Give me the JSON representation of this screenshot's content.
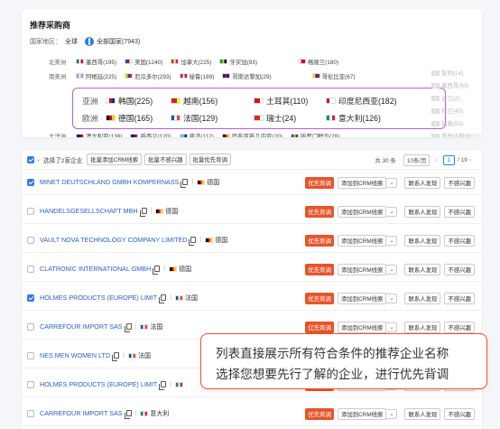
{
  "top_panel": {
    "title": "推荐采购商",
    "country_label": "国家地区：",
    "all_label": "全球",
    "all_countries": "全部国家(7943)",
    "regions": [
      {
        "name": "北美洲",
        "items": [
          {
            "label": "墨西哥(195)",
            "flag": [
              "#0a7a3a",
              "#fff",
              "#c8102e"
            ]
          },
          {
            "label": "美国(1240)",
            "flag": [
              "#2b4f9e",
              "#c8102e",
              "#fff"
            ]
          },
          {
            "label": "加拿大(225)",
            "flag": [
              "#d52b1e",
              "#fff",
              "#d52b1e"
            ]
          },
          {
            "label": "牙买加(93)",
            "flag": [
              "#009b3a",
              "#fed100",
              "#000"
            ]
          },
          {
            "label": "格陵兰(180)",
            "flag": [
              "#fff",
              "#c8102e",
              "#c8102e"
            ]
          }
        ]
      },
      {
        "name": "南美洲",
        "items": [
          {
            "label": "阿根廷(225)",
            "flag": [
              "#74acdf",
              "#fff",
              "#74acdf"
            ]
          },
          {
            "label": "厄瓜多尔(293)",
            "flag": [
              "#ffd100",
              "#034ea2",
              "#ed1c24"
            ]
          },
          {
            "label": "秘鲁(189)",
            "flag": [
              "#d91023",
              "#fff",
              "#d91023"
            ]
          },
          {
            "label": "哥斯达黎加(29)",
            "flag": [
              "#002b7f",
              "#ce1126",
              "#002b7f"
            ]
          },
          {
            "label": "哥伦比亚(67)",
            "flag": [
              "#fcd116",
              "#003893",
              "#ce1126"
            ]
          }
        ]
      }
    ],
    "highlight_regions": [
      {
        "name": "亚洲",
        "items": [
          {
            "label": "韩国(225)",
            "flag": [
              "#fff",
              "#c60c30",
              "#003478"
            ]
          },
          {
            "label": "越南(156)",
            "flag": [
              "#da251d",
              "#da251d",
              "#ffff00"
            ]
          },
          {
            "label": "土耳其(110)",
            "flag": [
              "#e30a17",
              "#e30a17",
              "#fff"
            ]
          },
          {
            "label": "印度尼西亚(182)",
            "flag": [
              "#ce1126",
              "#fff",
              "#fff"
            ]
          }
        ]
      },
      {
        "name": "欧洲",
        "items": [
          {
            "label": "德国(165)",
            "flag": [
              "#000",
              "#dd0000",
              "#ffce00"
            ]
          },
          {
            "label": "法国(129)",
            "flag": [
              "#0055a4",
              "#fff",
              "#ef4135"
            ]
          },
          {
            "label": "瑞士(24)",
            "flag": [
              "#d52b1e",
              "#d52b1e",
              "#fff"
            ]
          },
          {
            "label": "意大利(126)",
            "flag": [
              "#009246",
              "#fff",
              "#ce2b37"
            ]
          }
        ]
      }
    ],
    "faded_right": [
      "智利(14)",
      "墨西哥(63)",
      "波兰(2)",
      "荷兰(40)",
      "瑞典(55)",
      "哥斯达黎加(17)"
    ],
    "bottom_region": {
      "name": "大洋洲",
      "items": [
        {
          "label": "澳大利亚(138)",
          "flag": [
            "#012169",
            "#012169",
            "#c8102e"
          ]
        },
        {
          "label": "新西兰(120)",
          "flag": [
            "#012169",
            "#012169",
            "#c8102e"
          ]
        },
        {
          "label": "斐济(112)",
          "flag": [
            "#68bfe5",
            "#68bfe5",
            "#002868"
          ]
        },
        {
          "label": "巴布亚新几内亚(20)",
          "flag": [
            "#000",
            "#ce1126",
            "#fcd116"
          ]
        },
        {
          "label": "所罗门群岛(28)",
          "flag": [
            "#0051ba",
            "#fcd116",
            "#215b33"
          ]
        }
      ]
    }
  },
  "toolbar": {
    "selected_text": "选择了2家企业",
    "btn_add_crm": "批量添加CRM线索",
    "btn_not_interested": "批量不感兴趣",
    "btn_priority": "批量优先背调",
    "total": "共 30 条",
    "page_size": "10条/页",
    "page_input": "1",
    "page_total": "/ 19"
  },
  "rows": [
    {
      "name": "MINET DEUTSCHLAND GMBH KOMPERNASS",
      "country": "德国",
      "flag": [
        "#000",
        "#dd0000",
        "#ffce00"
      ],
      "checked": true
    },
    {
      "name": "HANDELSGESELLSCHAFT MBH",
      "country": "德国",
      "flag": [
        "#000",
        "#dd0000",
        "#ffce00"
      ],
      "checked": false
    },
    {
      "name": "VAULT NOVA TECHNOLOGY COMPANY LIMITED",
      "country": "德国",
      "flag": [
        "#000",
        "#dd0000",
        "#ffce00"
      ],
      "checked": false
    },
    {
      "name": "CLATRONIC INTERNATIONAL GMBH",
      "country": "德国",
      "flag": [
        "#000",
        "#dd0000",
        "#ffce00"
      ],
      "checked": false
    },
    {
      "name": "HOLMES PRODUCTS (EUROPE) LIMIT",
      "country": "法国",
      "flag": [
        "#0055a4",
        "#fff",
        "#ef4135"
      ],
      "checked": true
    },
    {
      "name": "CARREFOUR IMPORT SAS",
      "country": "法国",
      "flag": [
        "#0055a4",
        "#fff",
        "#ef4135"
      ],
      "checked": false
    },
    {
      "name": "NES MEN WOMEN LTD",
      "country": "法国",
      "flag": [
        "#0055a4",
        "#fff",
        "#ef4135"
      ],
      "checked": false
    },
    {
      "name": "HOLMES PRODUCTS (EUROPE) LIMIT",
      "country": "",
      "flag": [
        "#009246",
        "#fff",
        "#ce2b37"
      ],
      "checked": false
    },
    {
      "name": "CARREFOUR IMPORT SAS",
      "country": "意大利",
      "flag": [
        "#009246",
        "#fff",
        "#ce2b37"
      ],
      "checked": false
    }
  ],
  "row_actions": {
    "priority": "优先背调",
    "add_crm": "添加到CRM线索",
    "dropdown": "⌄",
    "contact": "联系人发现",
    "not_interested": "不感兴趣"
  },
  "callout": {
    "line1": "列表直接展示所有符合条件的推荐企业名称",
    "line2": "选择您想要先行了解的企业，进行优先背调"
  },
  "colors": {
    "accent": "#e8542a",
    "link": "#2b5fbd",
    "highlight_border": "#b860c9",
    "primary": "#2b7de9"
  }
}
